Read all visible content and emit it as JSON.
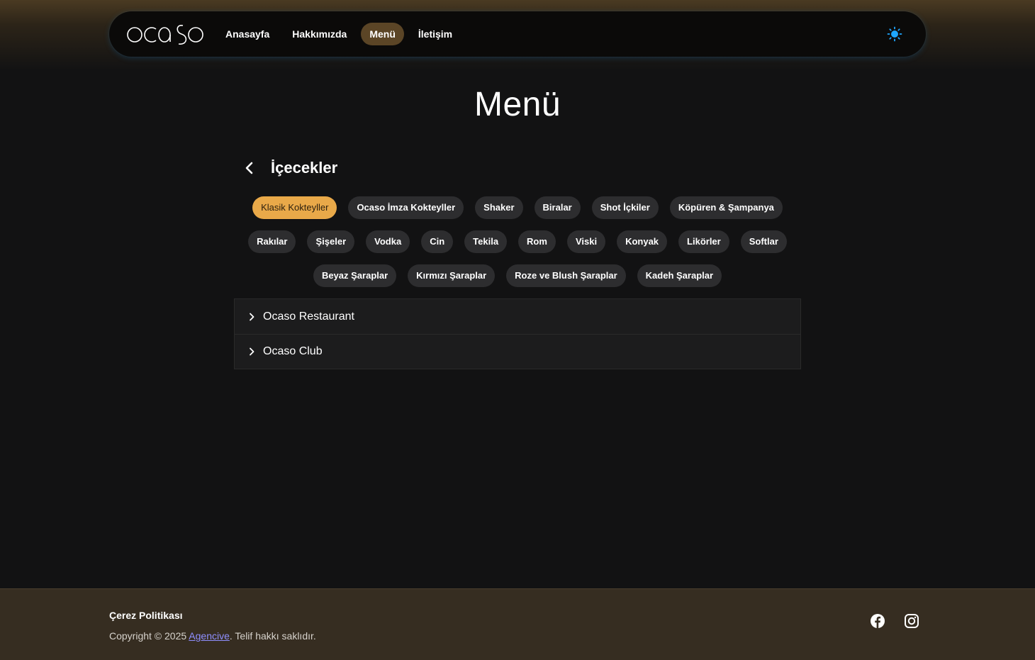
{
  "brand": {
    "logo_text": "ocaso"
  },
  "nav": {
    "items": [
      {
        "label": "Anasayfa",
        "active": false
      },
      {
        "label": "Hakkımızda",
        "active": false
      },
      {
        "label": "Menü",
        "active": true
      },
      {
        "label": "İletişim",
        "active": false
      }
    ],
    "theme_icon": "sun-icon"
  },
  "page": {
    "title": "Menü"
  },
  "section": {
    "title": "İçecekler",
    "back_icon": "chevron-left-icon"
  },
  "categories": {
    "rows": [
      [
        {
          "label": "Klasik Kokteyller",
          "active": true
        },
        {
          "label": "Ocaso İmza Kokteyller"
        },
        {
          "label": "Shaker"
        },
        {
          "label": "Biralar"
        },
        {
          "label": "Shot İçkiler"
        },
        {
          "label": "Köpüren & Şampanya"
        }
      ],
      [
        {
          "label": "Rakılar"
        },
        {
          "label": "Şişeler"
        },
        {
          "label": "Vodka"
        },
        {
          "label": "Cin"
        },
        {
          "label": "Tekila"
        },
        {
          "label": "Rom"
        },
        {
          "label": "Viski"
        },
        {
          "label": "Konyak"
        },
        {
          "label": "Likörler"
        },
        {
          "label": "Softlar"
        }
      ],
      [
        {
          "label": "Beyaz Şaraplar"
        },
        {
          "label": "Kırmızı Şaraplar"
        },
        {
          "label": "Roze ve Blush Şaraplar"
        },
        {
          "label": "Kadeh Şaraplar"
        }
      ]
    ]
  },
  "accordion": {
    "items": [
      {
        "label": "Ocaso Restaurant"
      },
      {
        "label": "Ocaso Club"
      }
    ]
  },
  "footer": {
    "cookie_link": "Çerez Politikası",
    "copyright_prefix": "Copyright © 2025 ",
    "agency_link": "Agencive",
    "copyright_suffix": ". Telif hakkı saklıdır.",
    "social": [
      "facebook-icon",
      "instagram-icon"
    ]
  },
  "colors": {
    "accent": "#e9a949",
    "nav_active": "#5b4526",
    "theme_icon": "#1ea7ff",
    "footer_bg": "#362d21",
    "link": "#8f8fff"
  }
}
